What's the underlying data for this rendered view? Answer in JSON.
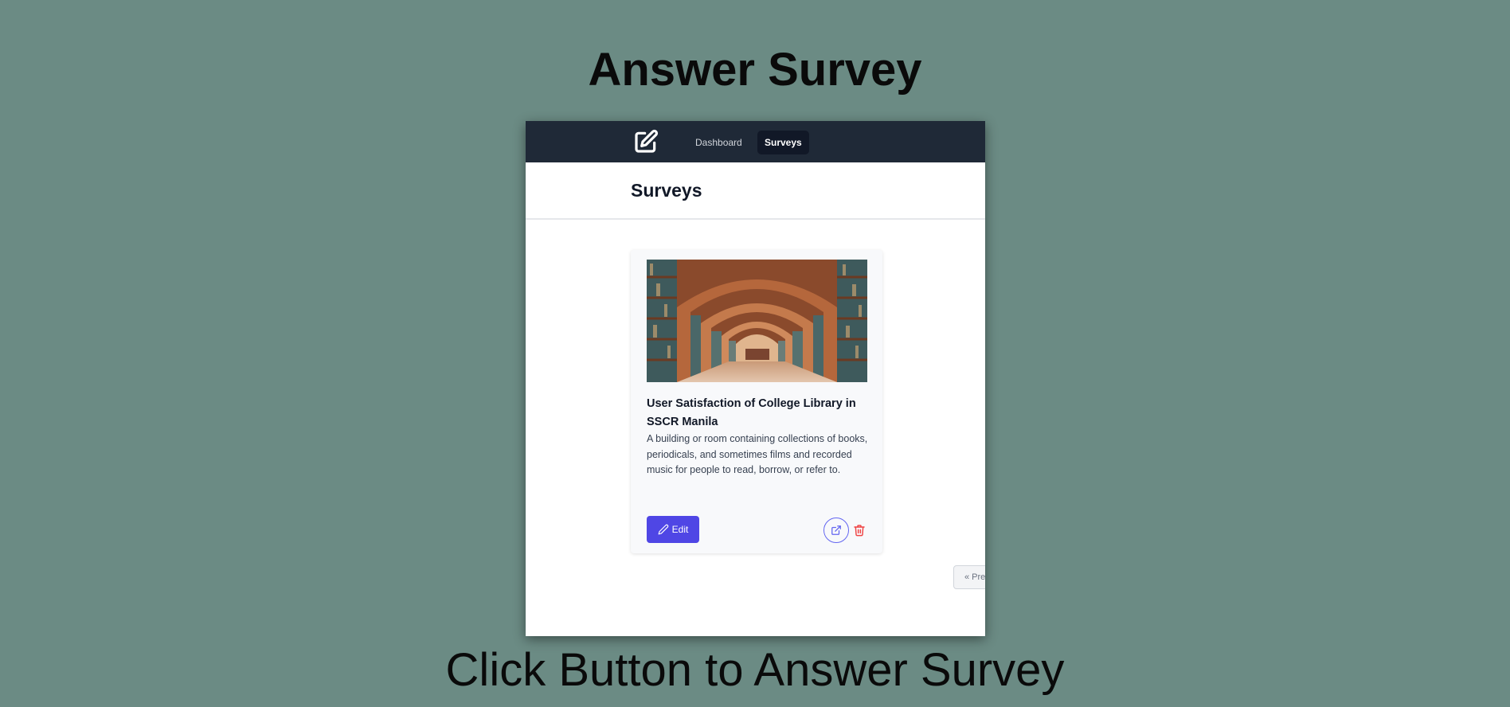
{
  "slide": {
    "title": "Answer Survey",
    "caption": "Click Button to Answer Survey"
  },
  "nav": {
    "logo_icon": "pencil-square-icon",
    "links": [
      {
        "label": "Dashboard",
        "active": false
      },
      {
        "label": "Surveys",
        "active": true
      }
    ]
  },
  "page": {
    "title": "Surveys"
  },
  "survey_card": {
    "image_alt": "library-arches-image",
    "title": "User Satisfaction of College Library in SSCR Manila",
    "description": "A building or room containing collections of books, periodicals, and sometimes films and recorded music for people to read, borrow, or refer to.",
    "edit_label": "Edit",
    "edit_icon": "pencil-icon",
    "open_icon": "external-link-icon",
    "delete_icon": "trash-icon"
  },
  "pagination": {
    "prev_label": "« Previous"
  },
  "colors": {
    "background": "#6b8b84",
    "navbar": "#1f2937",
    "accent": "#4f46e5",
    "danger": "#ef4444"
  }
}
